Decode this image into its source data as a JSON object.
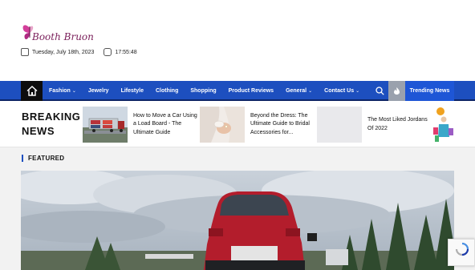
{
  "site": {
    "logo_text": "Booth Bruon",
    "date": "Tuesday, July 18th, 2023",
    "time": "17:55:48"
  },
  "nav": {
    "items": [
      {
        "label": "Fashion",
        "dropdown": true
      },
      {
        "label": "Jewelry",
        "dropdown": false
      },
      {
        "label": "Lifestyle",
        "dropdown": false
      },
      {
        "label": "Clothing",
        "dropdown": false
      },
      {
        "label": "Shopping",
        "dropdown": false
      },
      {
        "label": "Product Reviews",
        "dropdown": false
      },
      {
        "label": "General",
        "dropdown": true
      },
      {
        "label": "Contact Us",
        "dropdown": true
      }
    ],
    "chevron": "⌄",
    "trending_label": "Trending News"
  },
  "breaking": {
    "label_line1": "BREAKING",
    "label_line2": "NEWS",
    "items": [
      {
        "title": "How to Move a Car Using a Load Board - The Ultimate Guide"
      },
      {
        "title": "Beyond the Dress: The Ultimate Guide to Bridal Accessories for..."
      },
      {
        "title": "The Most Liked Jordans Of 2022"
      }
    ]
  },
  "featured": {
    "label": "FEATURED"
  },
  "colors": {
    "nav_blue": "#1d4fbf",
    "trending_blue": "#1e56d6",
    "brand_magenta": "#7a1f5a"
  },
  "icons": [
    "butterfly-logo-icon",
    "calendar-icon",
    "clock-icon",
    "home-icon",
    "search-icon",
    "fire-icon",
    "recaptcha-icon"
  ]
}
